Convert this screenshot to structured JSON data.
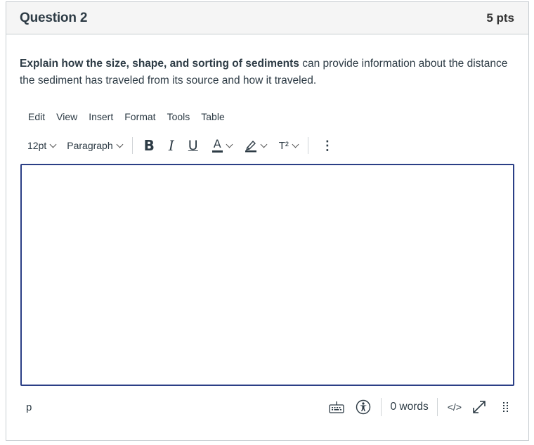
{
  "question": {
    "title": "Question 2",
    "points": "5 pts",
    "prompt_bold": "Explain how the size, shape, and sorting of sediments",
    "prompt_rest": " can provide information about the distance the sediment has traveled from its source and how it traveled."
  },
  "menubar": {
    "items": [
      "Edit",
      "View",
      "Insert",
      "Format",
      "Tools",
      "Table"
    ]
  },
  "toolbar": {
    "font_size": "12pt",
    "block_format": "Paragraph",
    "bold_label": "B",
    "italic_label": "I",
    "underline_label": "U",
    "text_color_label": "A",
    "superscript_label": "T²",
    "more_label": "⋮"
  },
  "editor": {
    "content": ""
  },
  "statusbar": {
    "path": "p",
    "word_count": "0 words",
    "html_toggle": "</>"
  },
  "colors": {
    "editor_focus_border": "#2b3f86",
    "header_bg": "#f5f5f5",
    "text": "#2d3b45"
  }
}
